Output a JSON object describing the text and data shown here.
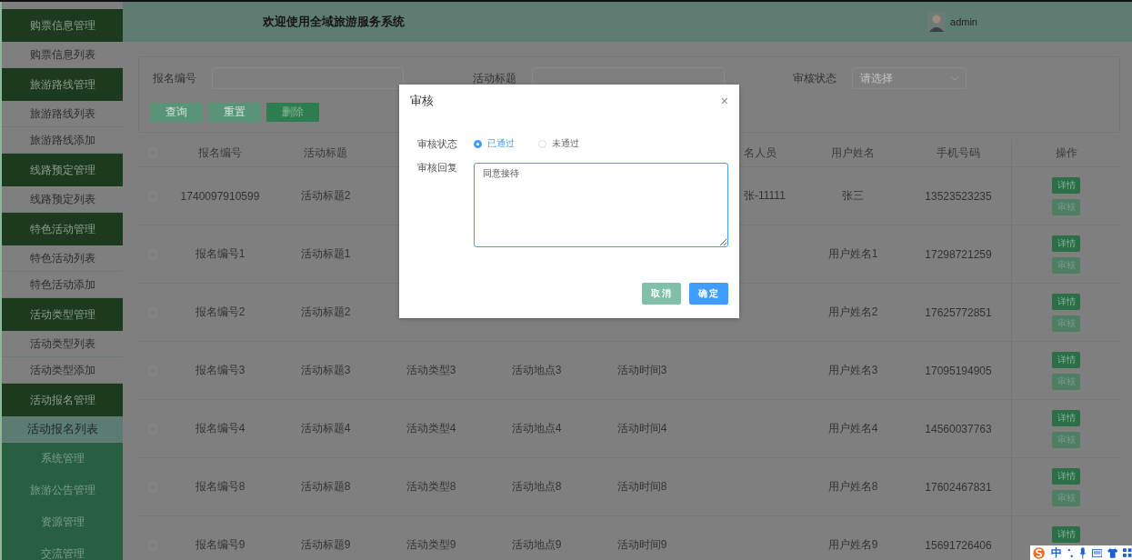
{
  "sidebar": {
    "items": [
      {
        "label": "购票信息管理",
        "kind": "group",
        "selected": false
      },
      {
        "label": "购票信息列表",
        "kind": "item",
        "selected": false
      },
      {
        "label": "旅游路线管理",
        "kind": "group",
        "selected": false
      },
      {
        "label": "旅游路线列表",
        "kind": "item",
        "selected": false
      },
      {
        "label": "旅游路线添加",
        "kind": "item",
        "selected": false
      },
      {
        "label": "线路预定管理",
        "kind": "group",
        "selected": false
      },
      {
        "label": "线路预定列表",
        "kind": "item",
        "selected": false
      },
      {
        "label": "特色活动管理",
        "kind": "group",
        "selected": false
      },
      {
        "label": "特色活动列表",
        "kind": "item",
        "selected": false
      },
      {
        "label": "特色活动添加",
        "kind": "item",
        "selected": false
      },
      {
        "label": "活动类型管理",
        "kind": "group",
        "selected": false
      },
      {
        "label": "活动类型列表",
        "kind": "item",
        "selected": false
      },
      {
        "label": "活动类型添加",
        "kind": "item",
        "selected": false
      },
      {
        "label": "活动报名管理",
        "kind": "group",
        "selected": false
      },
      {
        "label": "活动报名列表",
        "kind": "item",
        "selected": true
      },
      {
        "label": "系统管理",
        "kind": "module",
        "selected": false
      },
      {
        "label": "旅游公告管理",
        "kind": "module",
        "selected": false
      },
      {
        "label": "资源管理",
        "kind": "module",
        "selected": false
      },
      {
        "label": "交流管理",
        "kind": "module",
        "selected": false
      }
    ]
  },
  "header": {
    "title": "欢迎使用全域旅游服务系统",
    "user": "admin"
  },
  "search": {
    "fields": [
      {
        "label": "报名编号",
        "kind": "input"
      },
      {
        "label": "活动标题",
        "kind": "input"
      },
      {
        "label": "审核状态",
        "kind": "select",
        "placeholder": "请选择"
      }
    ],
    "buttons": [
      {
        "label": "查询",
        "kind": "secondary"
      },
      {
        "label": "重置",
        "kind": "secondary"
      },
      {
        "label": "删除",
        "kind": "danger"
      }
    ]
  },
  "table": {
    "header_checked": false,
    "columns": [
      "报名编号",
      "活动标题",
      null,
      null,
      null,
      "名人员",
      "用户姓名",
      "手机号码",
      "操作"
    ],
    "rows": [
      {
        "checked": false,
        "cells": [
          "1740097910599",
          "活动标题2",
          null,
          null,
          null,
          "张-11111",
          "张三",
          "13523523235"
        ],
        "actions": [
          "详情",
          "审核"
        ]
      },
      {
        "checked": false,
        "cells": [
          "报名编号1",
          "活动标题1",
          null,
          null,
          null,
          null,
          "用户姓名1",
          "17298721259"
        ],
        "actions": [
          "详情",
          "审核"
        ]
      },
      {
        "checked": false,
        "cells": [
          "报名编号2",
          "活动标题2",
          null,
          null,
          null,
          null,
          "用户姓名2",
          "17625772851"
        ],
        "actions": [
          "详情",
          "审核"
        ]
      },
      {
        "checked": false,
        "cells": [
          "报名编号3",
          "活动标题3",
          "活动类型3",
          "活动地点3",
          "活动时间3",
          null,
          "用户姓名3",
          "17095194905"
        ],
        "actions": [
          "详情",
          "审核"
        ]
      },
      {
        "checked": false,
        "cells": [
          "报名编号4",
          "活动标题4",
          "活动类型4",
          "活动地点4",
          "活动时间4",
          null,
          "用户姓名4",
          "14560037763"
        ],
        "actions": [
          "详情",
          "审核"
        ]
      },
      {
        "checked": false,
        "cells": [
          "报名编号8",
          "活动标题8",
          "活动类型8",
          "活动地点8",
          "活动时间8",
          null,
          "用户姓名8",
          "17602467831"
        ],
        "actions": [
          "详情",
          "审核"
        ]
      },
      {
        "checked": false,
        "cells": [
          "报名编号9",
          "活动标题9",
          "活动类型9",
          "活动地点9",
          "活动时间9",
          null,
          "用户姓名9",
          "15691726406"
        ],
        "actions": [
          "详情"
        ]
      }
    ]
  },
  "dialog": {
    "title": "审核",
    "close": "×",
    "status_label": "审核状态",
    "status_options": [
      {
        "label": "已通过",
        "selected": true
      },
      {
        "label": "未通过",
        "selected": false
      }
    ],
    "reply_label": "审核回复",
    "reply": "同意接待",
    "buttons": [
      {
        "label": "取消",
        "kind": "cancel"
      },
      {
        "label": "确定",
        "kind": "confirm"
      }
    ]
  },
  "ime": {
    "language": "中"
  }
}
